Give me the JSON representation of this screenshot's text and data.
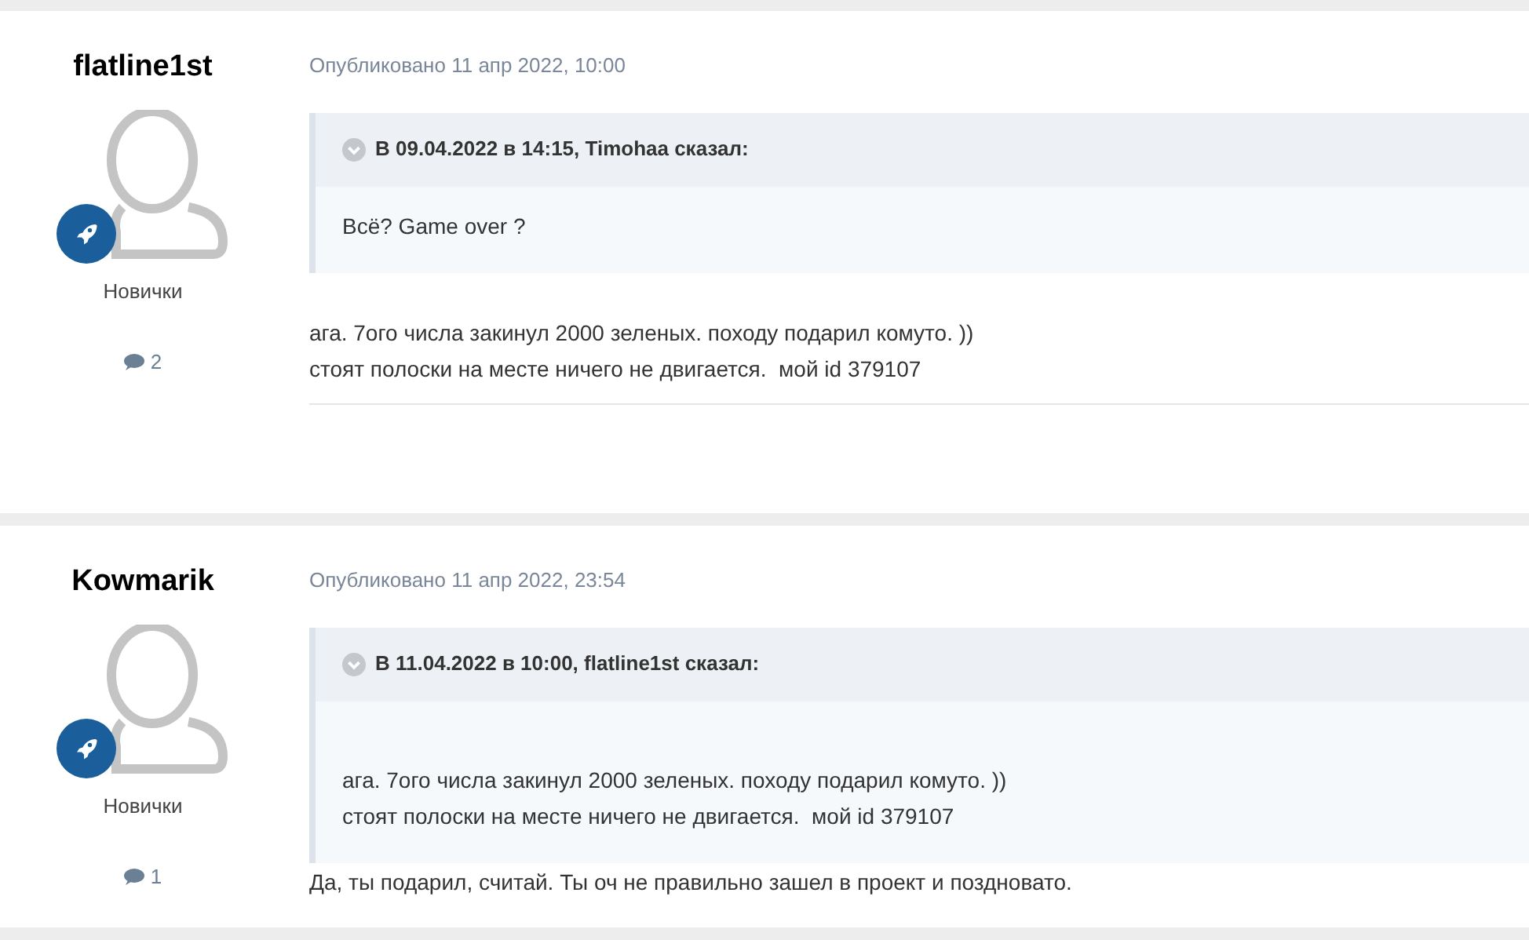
{
  "posts": [
    {
      "author": "flatline1st",
      "group": "Новички",
      "post_count": "2",
      "published": "Опубликовано 11 апр 2022, 10:00",
      "quote": {
        "header": "В 09.04.2022 в 14:15, Timohaa сказал:",
        "lines": [
          "Всё? Game over ?"
        ],
        "blank_first": false
      },
      "body": [
        "ага. 7ого числа закинул 2000 зеленых. походу подарил комуто. ))",
        "стоят полоски на месте ничего не двигается.  мой id 379107"
      ],
      "divider": true
    },
    {
      "author": "Kowmarik",
      "group": "Новички",
      "post_count": "1",
      "published": "Опубликовано 11 апр 2022, 23:54",
      "quote": {
        "header": "В 11.04.2022 в 10:00, flatline1st сказал:",
        "lines": [
          "ага. 7ого числа закинул 2000 зеленых. походу подарил комуто. ))",
          "стоят полоски на месте ничего не двигается.  мой id 379107"
        ],
        "blank_first": true
      },
      "body": [
        "Да, ты подарил, считай. Ты оч не правильно зашел в проект и поздновато."
      ],
      "divider": false
    }
  ]
}
